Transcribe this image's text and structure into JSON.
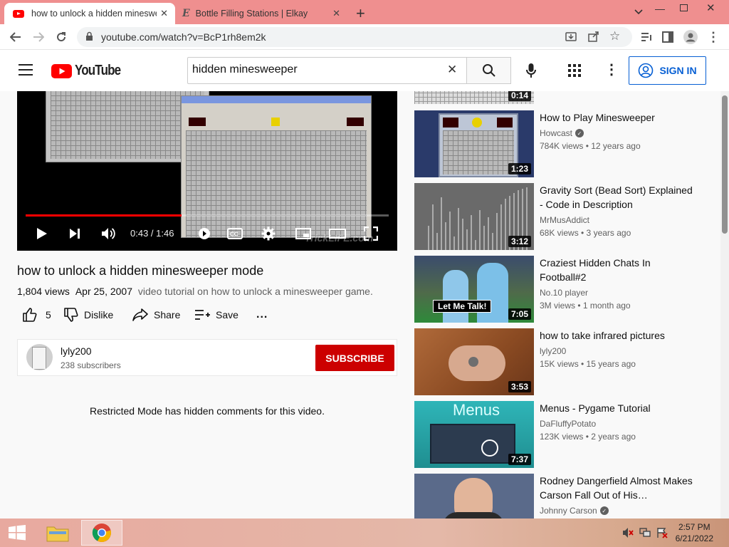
{
  "browser": {
    "tabs": [
      {
        "title": "how to unlock a hidden minesweeper mode - YouTube",
        "active": true
      },
      {
        "title": "Bottle Filling Stations | Elkay",
        "active": false
      }
    ],
    "new_tab": "+",
    "url": "youtube.com/watch?v=BcP1rh8em2k"
  },
  "youtube": {
    "logo_text": "YouTube",
    "search_value": "hidden minesweeper",
    "sign_in": "SIGN IN"
  },
  "player": {
    "time": "0:43 / 1:46",
    "progress": 0.43,
    "watermark": "TrickLIFE.com"
  },
  "video": {
    "title": "how to unlock a hidden minesweeper mode",
    "views": "1,804 views",
    "date": "Apr 25, 2007",
    "description": "video tutorial on how to unlock a minesweeper game.",
    "likes": "5",
    "dislike": "Dislike",
    "share": "Share",
    "save": "Save",
    "more": "..."
  },
  "channel": {
    "name": "lyly200",
    "subscribers": "238 subscribers",
    "subscribe": "SUBSCRIBE"
  },
  "comments_notice": "Restricted Mode has hidden comments for this video.",
  "recommendations": [
    {
      "title": "",
      "channel": "",
      "views": "",
      "duration": "0:14",
      "verified": false
    },
    {
      "title": "How to Play Minesweeper",
      "channel": "Howcast",
      "views": "784K views • 12 years ago",
      "duration": "1:23",
      "verified": true
    },
    {
      "title": "Gravity Sort (Bead Sort) Explained - Code in Description",
      "channel": "MrMusAddict",
      "views": "68K views • 3 years ago",
      "duration": "3:12",
      "verified": false
    },
    {
      "title": "Craziest Hidden Chats In Football#2",
      "channel": "No.10 player",
      "views": "3M views • 1 month ago",
      "duration": "7:05",
      "verified": false,
      "thumb_caption": "Let Me Talk!"
    },
    {
      "title": "how to take infrared pictures",
      "channel": "lyly200",
      "views": "15K views • 15 years ago",
      "duration": "3:53",
      "verified": false
    },
    {
      "title": "Menus - Pygame Tutorial",
      "channel": "DaFluffyPotato",
      "views": "123K views • 2 years ago",
      "duration": "7:37",
      "verified": false,
      "thumb_caption": "Menus"
    },
    {
      "title": "Rodney Dangerfield Almost Makes Carson Fall Out of His…",
      "channel": "Johnny Carson",
      "views": "",
      "duration": "",
      "verified": true
    }
  ],
  "taskbar": {
    "time": "2:57 PM",
    "date": "6/21/2022"
  },
  "colors": {
    "tab_strip": "#ef8f8f",
    "youtube_red": "#ff0000",
    "subscribe_red": "#cc0000",
    "signin_blue": "#065fd4"
  }
}
